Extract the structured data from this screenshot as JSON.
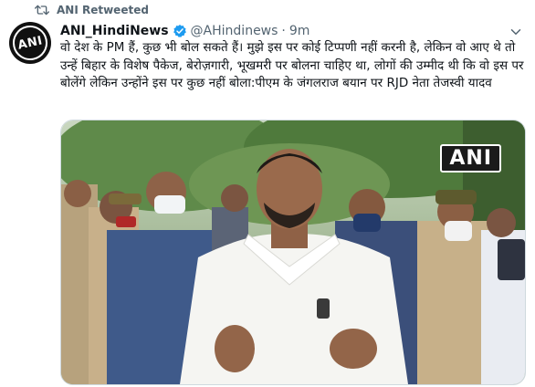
{
  "retweet": {
    "label": "ANI Retweeted",
    "icon": "retweet-icon"
  },
  "tweet": {
    "author_name": "ANI_HindiNews",
    "handle": "@AHindinews",
    "separator": "·",
    "time": "9m",
    "verified_icon": "verified-badge-icon",
    "text": "वो देश के PM हैं, कुछ भी बोल सकते हैं। मुझे इस पर कोई टिप्पणी नहीं करनी है, लेकिन वो आए थे तो उन्हें बिहार के विशेष पैकेज, बेरोज़गारी, भूखमरी पर बोलना चाहिए था, लोगों की उम्मीद थी कि वो इस पर बोलेंगे लेकिन उन्होंने इस पर कुछ नहीं बोला:पीएम के जंगलराज बयान पर RJD नेता तेजस्वी यादव"
  },
  "avatar": {
    "text": "ANI"
  },
  "media": {
    "watermark": "ANI"
  },
  "colors": {
    "text_primary": "#0f1419",
    "text_secondary": "#536471",
    "verified_blue": "#1d9bf0"
  }
}
